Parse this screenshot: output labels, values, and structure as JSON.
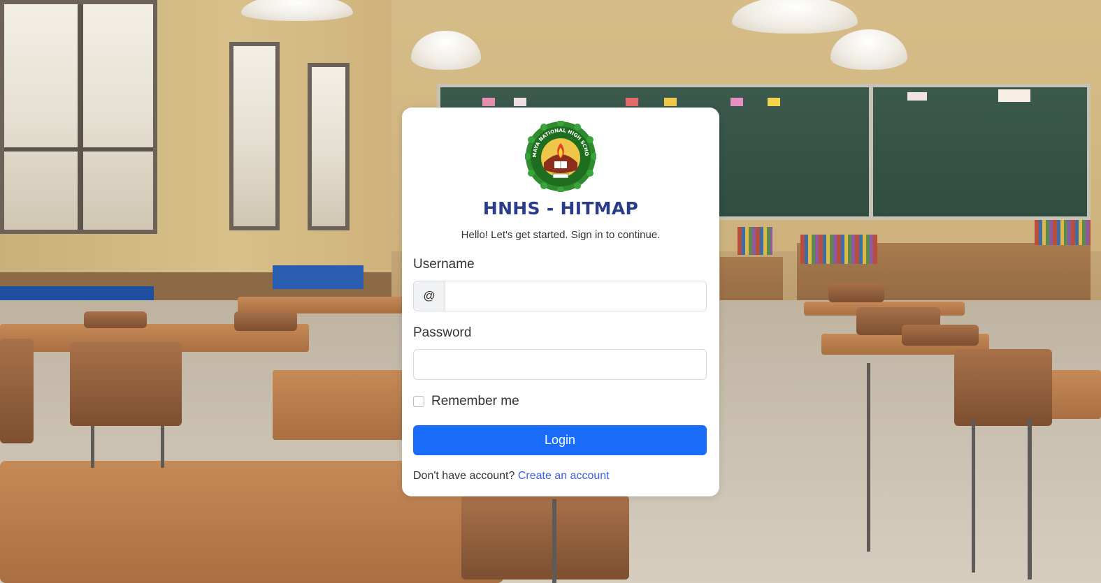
{
  "app": {
    "title": "HNHS - HITMAP",
    "subtitle": "Hello! Let's get started. Sign in to continue."
  },
  "logo": {
    "icon": "school-seal-logo",
    "text": "HIMAYA NATIONAL HIGH SCHOOL"
  },
  "form": {
    "username_label": "Username",
    "username_prefix": "@",
    "username_value": "",
    "password_label": "Password",
    "password_value": "",
    "remember_label": "Remember me",
    "login_label": "Login"
  },
  "footer": {
    "prompt": "Don't have account?",
    "link_label": "Create an account"
  },
  "colors": {
    "primary": "#1a6dfb",
    "title": "#2b3d8a",
    "link": "#3c5de8"
  }
}
